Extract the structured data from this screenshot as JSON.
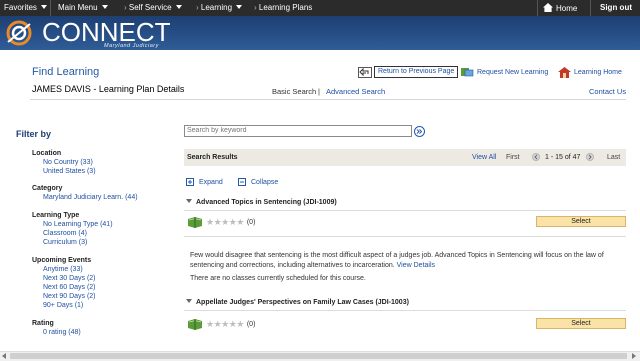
{
  "topnav": {
    "favorites": "Favorites",
    "main_menu": "Main Menu",
    "self_service": "Self Service",
    "learning": "Learning",
    "learning_plans": "Learning Plans",
    "home": "Home",
    "sign_out": "Sign out"
  },
  "banner": {
    "brand": "CONNECT",
    "subtitle": "Maryland Judiciary"
  },
  "header": {
    "title": "Find Learning",
    "user_line": "JAMES DAVIS   - Learning Plan Details",
    "return_link": "Return to Previous Page",
    "request_link": "Request New Learning",
    "home_link": "Learning Home",
    "basic_search": "Basic Search",
    "separator": "|",
    "advanced_search": "Advanced Search",
    "contact_us": "Contact Us"
  },
  "filters": {
    "heading": "Filter by",
    "groups": [
      {
        "label": "Location",
        "options": [
          "No Country (33)",
          "United States (3)"
        ]
      },
      {
        "label": "Category",
        "options": [
          "Maryland Judiciary Learn. (44)"
        ]
      },
      {
        "label": "Learning Type",
        "options": [
          "No Learning Type (41)",
          "Classroom (4)",
          "Curriculum (3)"
        ]
      },
      {
        "label": "Upcoming Events",
        "options": [
          "Anytime (33)",
          "Next 30 Days (2)",
          "Next 60 Days (2)",
          "Next 90 Days (2)",
          "90+ Days (1)"
        ]
      },
      {
        "label": "Rating",
        "options": [
          "0 rating (48)"
        ]
      }
    ]
  },
  "search": {
    "placeholder": "Search by keyword"
  },
  "results": {
    "label": "Search Results",
    "view_all": "View All",
    "first": "First",
    "range": "1 - 15 of 47",
    "last": "Last",
    "expand": "Expand",
    "collapse": "Collapse"
  },
  "courses": [
    {
      "title": "Advanced Topics in Sentencing (JDI-1009)",
      "rating_count": "(0)",
      "select_label": "Select",
      "description": "Few would disagree that sentencing is the most difficult aspect of a judges job. Advanced Topics in Sentencing will focus on the law of sentencing and corrections, including alternatives to incarceration.",
      "view_details": "View Details",
      "no_classes": "There are no classes currently scheduled for this course."
    },
    {
      "title": "Appellate Judges' Perspectives on Family Law Cases (JDI-1003)",
      "rating_count": "(0)",
      "select_label": "Select"
    }
  ],
  "colors": {
    "nav_bg": "#2b2b2b",
    "banner_bg": "#2f5c97",
    "link": "#1f4fa0",
    "select_btn": "#fbe2a7",
    "results_bar": "#eceae2"
  }
}
